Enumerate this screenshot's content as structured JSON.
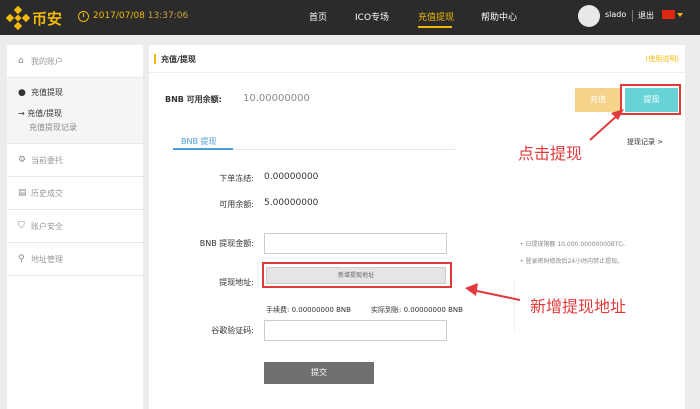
{
  "brand": {
    "name": "币安"
  },
  "header": {
    "date": "2017/07/08",
    "time": "13:37:06",
    "nav": [
      "首页",
      "ICO专场",
      "充值提现",
      "帮助中心"
    ],
    "active_nav": "充值提现",
    "username": "slado",
    "logout": "退出"
  },
  "sidebar": {
    "my_account": "我的账户",
    "deposit_withdraw": "充值提现",
    "sub_withdraw": "→ 充值/提现",
    "sub_history": "充值提现记录",
    "open_orders": "当前委托",
    "trade_history": "历史成交",
    "security": "账户安全",
    "address": "地址管理"
  },
  "main": {
    "title": "充值/提现",
    "help": "(使用说明)",
    "available_label": "BNB 可用余额:",
    "available_value": "10.00000000",
    "deposit_btn": "充值",
    "withdraw_btn": "提现",
    "tab": "BNB 提现",
    "history_link": "提现记录 >",
    "frozen_label": "下单冻结:",
    "frozen_value": "0.00000000",
    "balance_label": "可用余额:",
    "balance_value": "5.00000000",
    "amount_label": "BNB 提现金额:",
    "address_label": "提现地址:",
    "add_address_btn": "新增提现地址",
    "fee_text": "手续费: 0.00000000 BNB",
    "actual_text": "实际到账: 0.00000000 BNB",
    "google_label": "谷歌验证码:",
    "submit": "提交"
  },
  "notes": [
    "• 日提现限额 10,000.00000000BTC。",
    "• 登录密码修改后24小时内禁止提现。"
  ],
  "annotations": {
    "click_withdraw": "点击提现",
    "add_address": "新增提现地址"
  },
  "colors": {
    "accent": "#f0b90b",
    "highlight": "#e03a3a",
    "withdraw": "#68d3d6",
    "deposit": "#f5d38b"
  }
}
